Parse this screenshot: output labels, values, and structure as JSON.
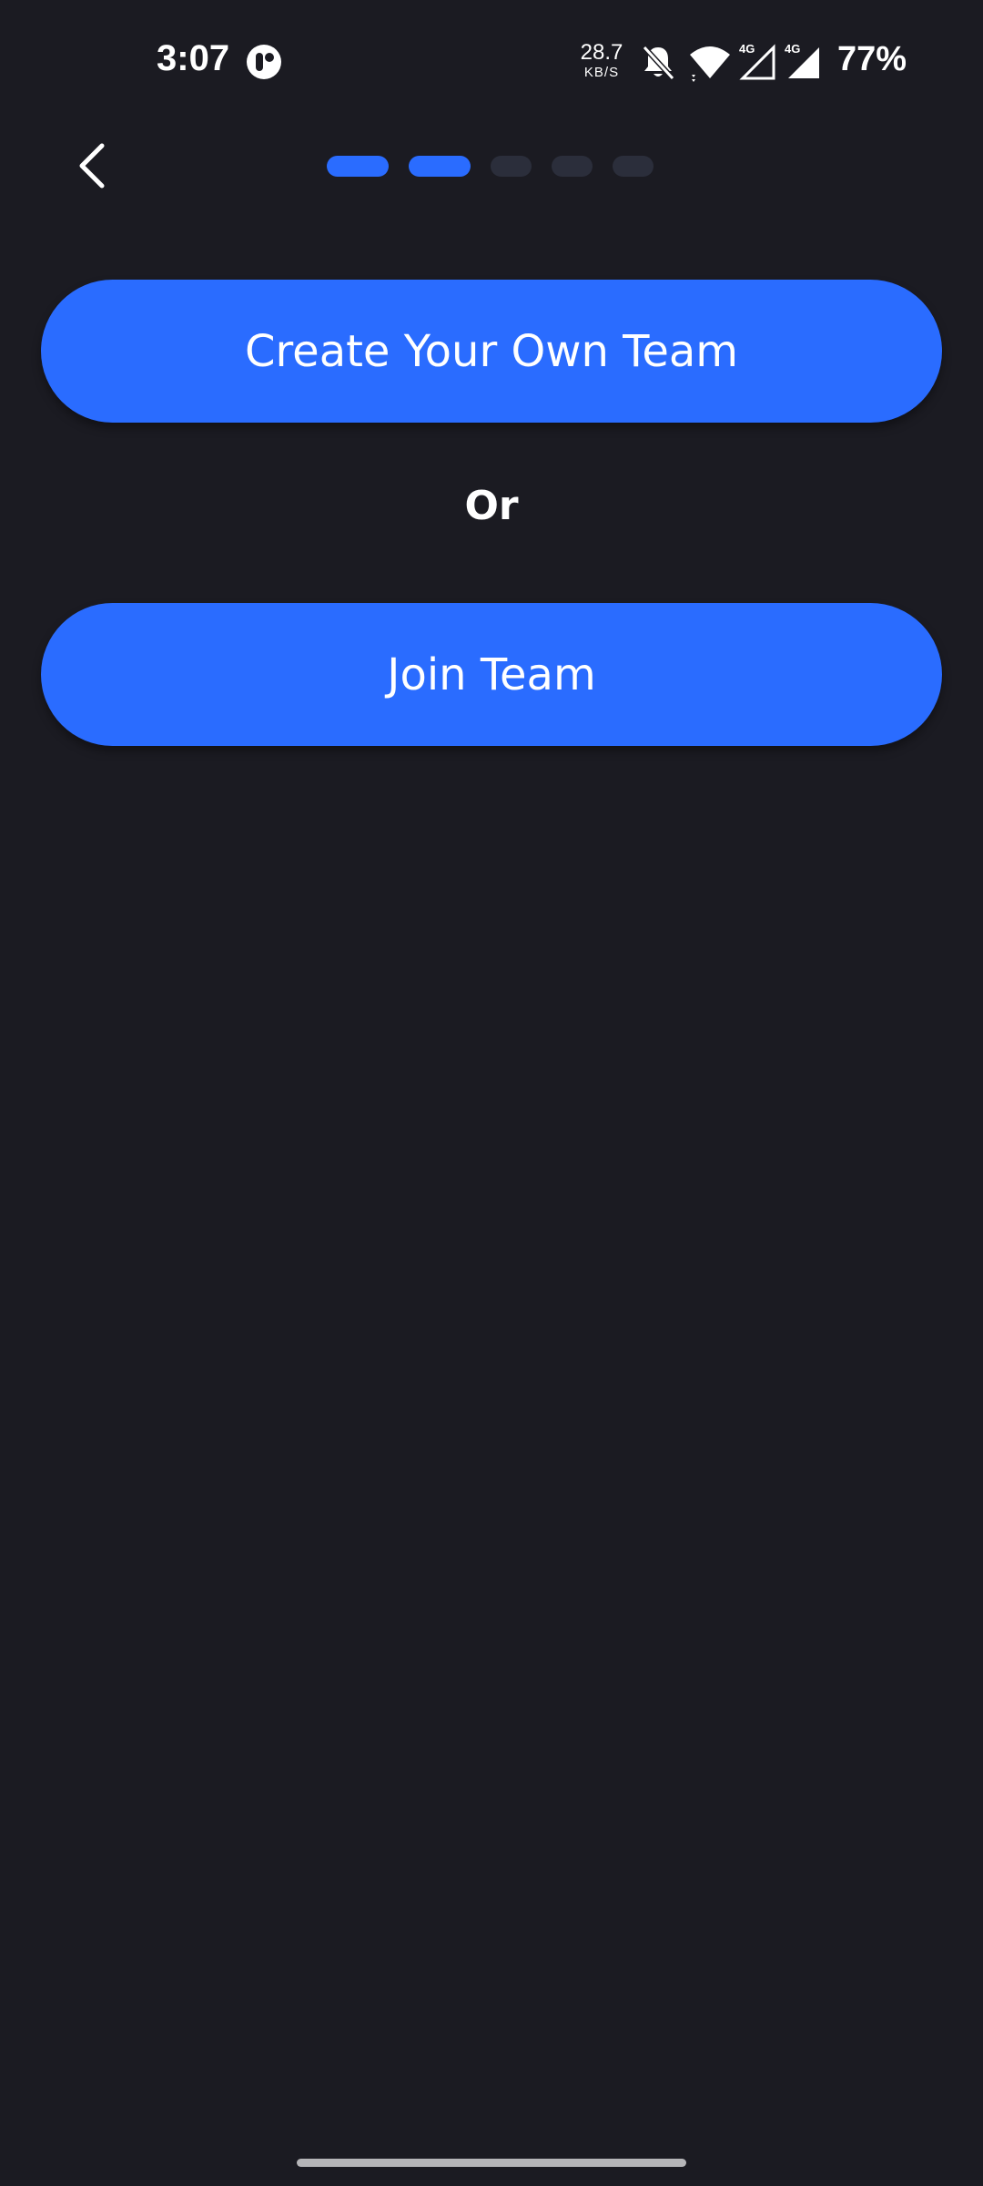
{
  "status_bar": {
    "time": "3:07",
    "net_speed": "28.7",
    "net_unit": "KB/S",
    "battery": "77%",
    "icons": [
      "app-icon",
      "bell-off-icon",
      "wifi-icon",
      "signal-4g-icon",
      "signal-4g-icon"
    ]
  },
  "header": {
    "back_icon": "chevron-left-icon",
    "progress": {
      "total_steps": 5,
      "completed_steps": 2
    }
  },
  "actions": {
    "create_team_label": "Create Your Own Team",
    "divider_label": "Or",
    "join_team_label": "Join Team"
  },
  "colors": {
    "background": "#1b1b22",
    "accent": "#2a6cff",
    "inactive_step": "#2b2e3b",
    "text": "#ffffff"
  }
}
